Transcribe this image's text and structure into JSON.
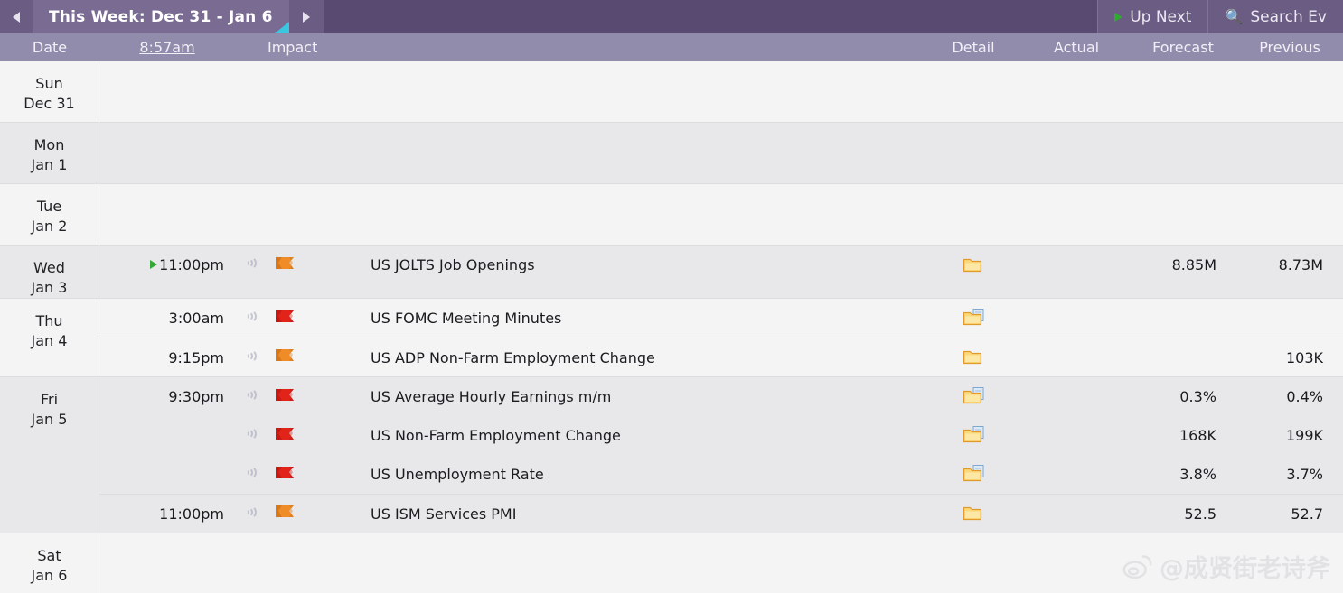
{
  "topbar": {
    "prev_arrow_icon": "triangle-left-icon",
    "next_arrow_icon": "triangle-right-icon",
    "week_tab_label": "This Week: Dec 31 - Jan 6",
    "tab_forward_icon": "triangle-right-icon",
    "up_next_label": "Up Next",
    "up_next_icon": "play-icon",
    "search_label": "Search Ev",
    "search_icon": "search-icon"
  },
  "columns": {
    "date": "Date",
    "time": "8:57am",
    "impact": "Impact",
    "detail": "Detail",
    "actual": "Actual",
    "forecast": "Forecast",
    "previous": "Previous"
  },
  "days": [
    {
      "dow": "Sun",
      "dom": "Dec 31",
      "shade": "base",
      "events": []
    },
    {
      "dow": "Mon",
      "dom": "Jan 1",
      "shade": "alt",
      "events": []
    },
    {
      "dow": "Tue",
      "dom": "Jan 2",
      "shade": "base",
      "events": []
    },
    {
      "dow": "Wed",
      "dom": "Jan 3",
      "shade": "alt",
      "events": [
        {
          "time": "11:00pm",
          "is_next": true,
          "speaker_icon": "audio-icon",
          "impact": "medium",
          "impact_icon": "orange-flag-icon",
          "title": "US JOLTS Job Openings",
          "detail_icon": "folder-icon",
          "actual": "",
          "forecast": "8.85M",
          "previous": "8.73M",
          "separator": false
        }
      ]
    },
    {
      "dow": "Thu",
      "dom": "Jan 4",
      "shade": "base",
      "events": [
        {
          "time": "3:00am",
          "is_next": false,
          "speaker_icon": "audio-icon",
          "impact": "high",
          "impact_icon": "red-flag-icon",
          "title": "US FOMC Meeting Minutes",
          "detail_icon": "folder-document-icon",
          "actual": "",
          "forecast": "",
          "previous": "",
          "separator": false
        },
        {
          "time": "9:15pm",
          "is_next": false,
          "speaker_icon": "audio-icon",
          "impact": "medium",
          "impact_icon": "orange-flag-icon",
          "title": "US ADP Non-Farm Employment Change",
          "detail_icon": "folder-icon",
          "actual": "",
          "forecast": "",
          "previous": "103K",
          "separator": true
        }
      ]
    },
    {
      "dow": "Fri",
      "dom": "Jan 5",
      "shade": "alt",
      "events": [
        {
          "time": "9:30pm",
          "is_next": false,
          "speaker_icon": "audio-icon",
          "impact": "high",
          "impact_icon": "red-flag-icon",
          "title": "US Average Hourly Earnings m/m",
          "detail_icon": "folder-document-icon",
          "actual": "",
          "forecast": "0.3%",
          "previous": "0.4%",
          "separator": false
        },
        {
          "time": "",
          "is_next": false,
          "speaker_icon": "audio-icon",
          "impact": "high",
          "impact_icon": "red-flag-icon",
          "title": "US Non-Farm Employment Change",
          "detail_icon": "folder-document-icon",
          "actual": "",
          "forecast": "168K",
          "previous": "199K",
          "separator": false
        },
        {
          "time": "",
          "is_next": false,
          "speaker_icon": "audio-icon",
          "impact": "high",
          "impact_icon": "red-flag-icon",
          "title": "US Unemployment Rate",
          "detail_icon": "folder-document-icon",
          "actual": "",
          "forecast": "3.8%",
          "previous": "3.7%",
          "separator": false
        },
        {
          "time": "11:00pm",
          "is_next": false,
          "speaker_icon": "audio-icon",
          "impact": "medium",
          "impact_icon": "orange-flag-icon",
          "title": "US ISM Services PMI",
          "detail_icon": "folder-icon",
          "actual": "",
          "forecast": "52.5",
          "previous": "52.7",
          "separator": true
        }
      ]
    },
    {
      "dow": "Sat",
      "dom": "Jan 6",
      "shade": "base",
      "events": []
    }
  ],
  "watermark": {
    "handle": "@成贤街老诗斧",
    "logo_icon": "weibo-logo-icon"
  },
  "colors": {
    "topbar": "#594A72",
    "tab_active": "#7A6B93",
    "column_header": "#918BAC",
    "row_base": "#F4F4F5",
    "row_alt": "#E8E8EA",
    "impact_high": "#E2231A",
    "impact_medium": "#F08C28",
    "next_marker": "#35A935",
    "tab_corner": "#39C7E0"
  }
}
